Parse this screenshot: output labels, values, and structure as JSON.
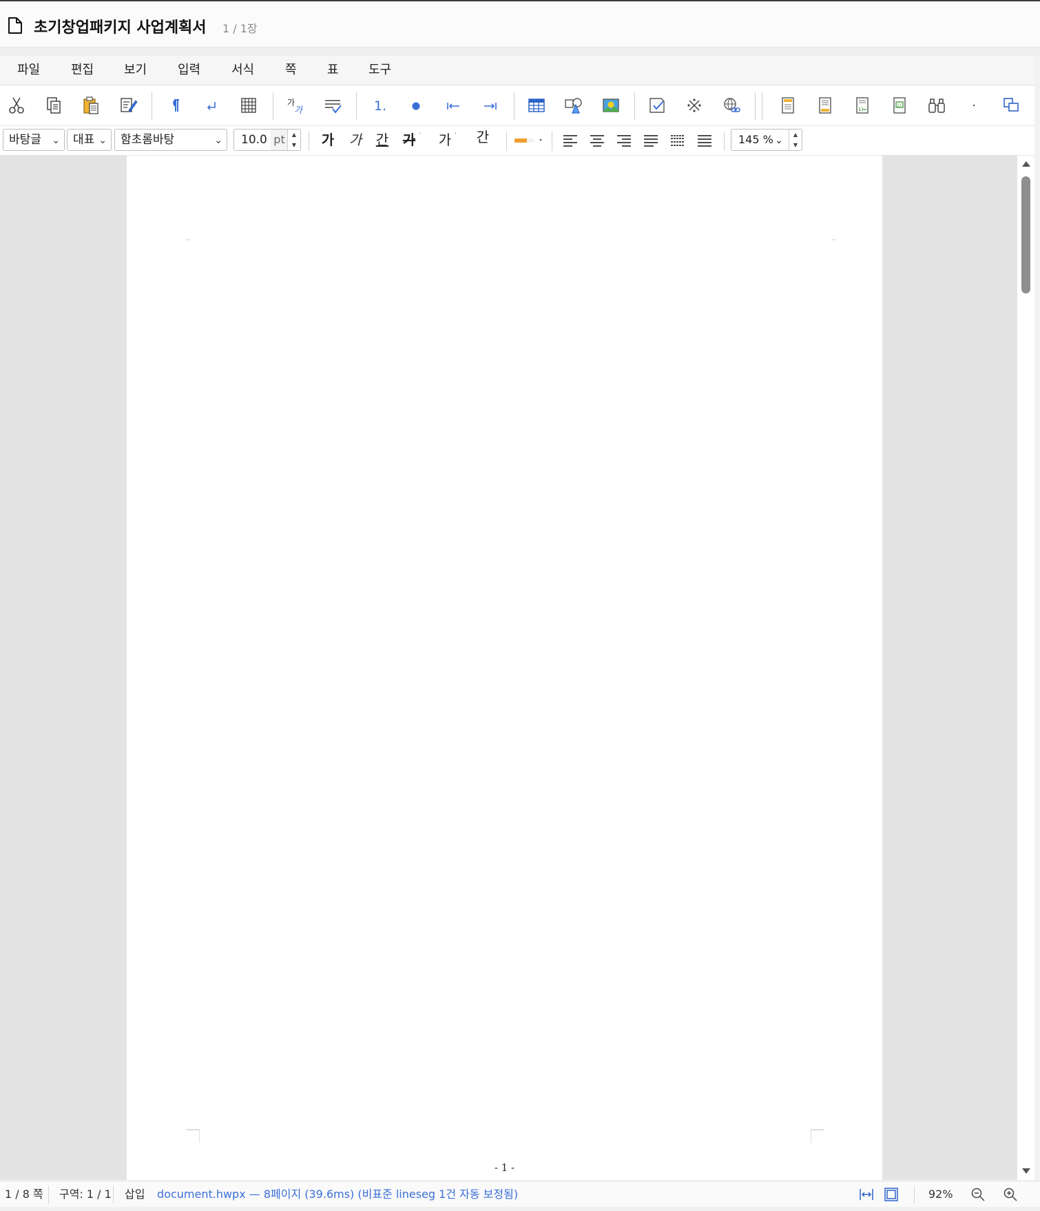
{
  "title": {
    "document_name": "초기창업패키지 사업계획서",
    "page_indicator": "1 / 1장"
  },
  "menu": [
    "파일",
    "편집",
    "보기",
    "입력",
    "서식",
    "쪽",
    "표",
    "도구"
  ],
  "toolbar_icons": [
    "cut-icon",
    "copy-icon",
    "paste-icon",
    "format-painter-icon",
    "paragraph-mark-icon",
    "line-break-icon",
    "grid-icon",
    "char-shape-icon",
    "para-shape-icon",
    "numbered-list-icon",
    "bullet-list-icon",
    "outdent-icon",
    "indent-icon",
    "table-icon",
    "shapes-icon",
    "image-icon",
    "comment-icon",
    "symbol-icon",
    "hyperlink-icon",
    "header-icon",
    "footer-icon",
    "footnote-icon",
    "endnote-icon",
    "find-icon",
    "more-icon",
    "window-icon"
  ],
  "format": {
    "style": "바탕글",
    "lang": "대표",
    "font": "함초롬바탕",
    "font_size": "10.0",
    "font_unit": "pt",
    "bold": "가",
    "italic": "가",
    "underline": "간",
    "strike": "가",
    "char_color": "가",
    "emphasis": "간",
    "zoom": "145 %",
    "highlight_color": "#f0a030"
  },
  "page": {
    "number_text": "- 1 -"
  },
  "status": {
    "page": "1 / 8 쪽",
    "section": "구역: 1 / 1",
    "mode": "삽입",
    "message": "document.hwpx — 8페이지 (39.6ms) (비표준 lineseg 1건 자동 보정됨)",
    "zoom": "92%"
  },
  "colors": {
    "accent_blue": "#3b6fd8",
    "workspace_gray": "#e3e3e3"
  }
}
